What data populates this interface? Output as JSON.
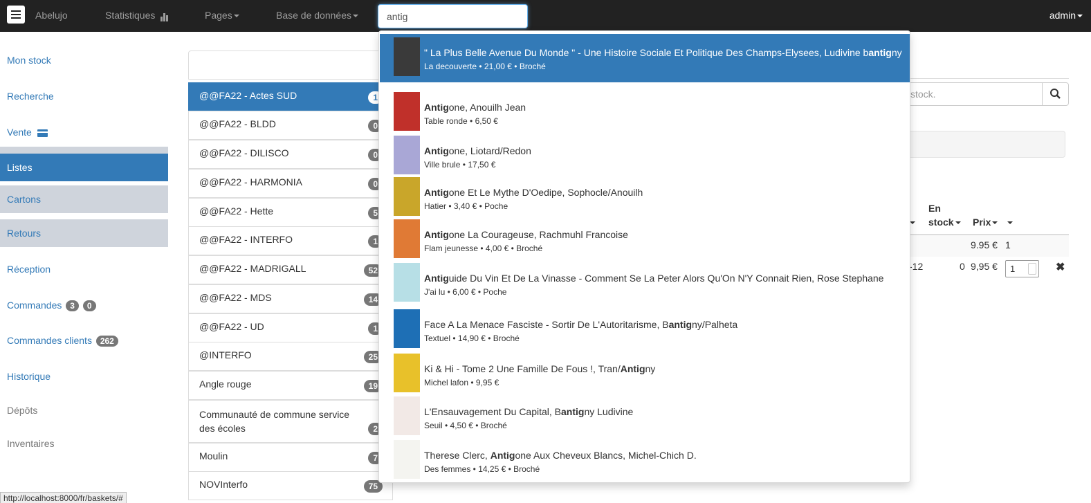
{
  "navbar": {
    "brand": "Abelujo",
    "stats": "Statistiques",
    "pages": "Pages",
    "database": "Base de données",
    "search_value": "antig",
    "user": "admin"
  },
  "sidebar": {
    "items": [
      {
        "label": "Mon stock"
      },
      {
        "label": "Recherche"
      },
      {
        "label": "Vente"
      },
      {
        "label": "Listes"
      },
      {
        "label": "Cartons"
      },
      {
        "label": "Retours"
      },
      {
        "label": "Réception"
      },
      {
        "label": "Commandes",
        "badge1": "3",
        "badge2": "0"
      },
      {
        "label": "Commandes clients",
        "badge": "262"
      },
      {
        "label": "Historique"
      },
      {
        "label": "Dépôts"
      },
      {
        "label": "Inventaires"
      }
    ]
  },
  "lists": [
    {
      "name": "@@FA22 - Actes SUD",
      "count": "1"
    },
    {
      "name": "@@FA22 - BLDD",
      "count": "0"
    },
    {
      "name": "@@FA22 - DILISCO",
      "count": "0"
    },
    {
      "name": "@@FA22 - HARMONIA",
      "count": "0"
    },
    {
      "name": "@@FA22 - Hette",
      "count": "5"
    },
    {
      "name": "@@FA22 - INTERFO",
      "count": "1"
    },
    {
      "name": "@@FA22 - MADRIGALL",
      "count": "52"
    },
    {
      "name": "@@FA22 - MDS",
      "count": "14"
    },
    {
      "name": "@@FA22 - UD",
      "count": "1"
    },
    {
      "name": "@INTERFO",
      "count": "25"
    },
    {
      "name": "Angle rouge",
      "count": "19"
    },
    {
      "name": "Communauté de commune service des écoles",
      "count": "2"
    },
    {
      "name": "Moulin",
      "count": "7"
    },
    {
      "name": "NOVInterfo",
      "count": "75"
    }
  ],
  "right_panel": {
    "search_placeholder": "stock.",
    "col_en": "En",
    "col_stock": "stock",
    "col_prix": "Prix",
    "row1": {
      "prix": "9.95 €",
      "qty": "1"
    },
    "row2": {
      "date": "-12",
      "stock": "0",
      "prix": "9,95 €",
      "qty": "1"
    }
  },
  "autocomplete": [
    {
      "pre": "\" La Plus Belle Avenue Du Monde \" - Une Histoire Sociale Et Politique Des Champs-Elysees, Ludivine b",
      "match": "antig",
      "post": "ny",
      "sub": "La decouverte • 21,00 € • Broché",
      "color": "#3a3a3a"
    },
    {
      "pre": "",
      "match": "Antig",
      "post": "one, Anouilh Jean",
      "sub": "Table ronde • 6,50 €",
      "color": "#c0302a"
    },
    {
      "pre": "",
      "match": "Antig",
      "post": "one, Liotard/Redon",
      "sub": "Ville brule • 17,50 €",
      "color": "#a9a7d6"
    },
    {
      "pre": "",
      "match": "Antig",
      "post": "one Et Le Mythe D'Oedipe, Sophocle/Anouilh",
      "sub": "Hatier • 3,40 € • Poche",
      "color": "#c9a62a"
    },
    {
      "pre": "",
      "match": "Antig",
      "post": "one La Courageuse, Rachmuhl Francoise",
      "sub": "Flam jeunesse • 4,00 € • Broché",
      "color": "#e07a35"
    },
    {
      "pre": "",
      "match": "Antig",
      "post": "uide Du Vin Et De La Vinasse - Comment Se La Peter Alors Qu'On N'Y Connait Rien, Rose Stephane",
      "sub": "J'ai lu • 6,00 € • Poche",
      "color": "#b7dfe6"
    },
    {
      "pre": "Face A La Menace Fasciste - Sortir De L'Autoritarisme, B",
      "match": "antig",
      "post": "ny/Palheta",
      "sub": "Textuel • 14,90 € • Broché",
      "color": "#1e6fb5"
    },
    {
      "pre": "Ki & Hi - Tome 2 Une Famille De Fous !, Tran/",
      "match": "Antig",
      "post": "ny",
      "sub": "Michel lafon • 9,95 €",
      "color": "#e8c12a"
    },
    {
      "pre": "L'Ensauvagement Du Capital, B",
      "match": "antig",
      "post": "ny Ludivine",
      "sub": "Seuil • 4,50 € • Broché",
      "color": "#f2e9e6"
    },
    {
      "pre": "Therese Clerc, ",
      "match": "Antig",
      "post": "one Aux Cheveux Blancs, Michel-Chich D.",
      "sub": "Des femmes • 14,25 € • Broché",
      "color": "#f4f4f0"
    }
  ],
  "status_url": "http://localhost:8000/fr/baskets/#"
}
